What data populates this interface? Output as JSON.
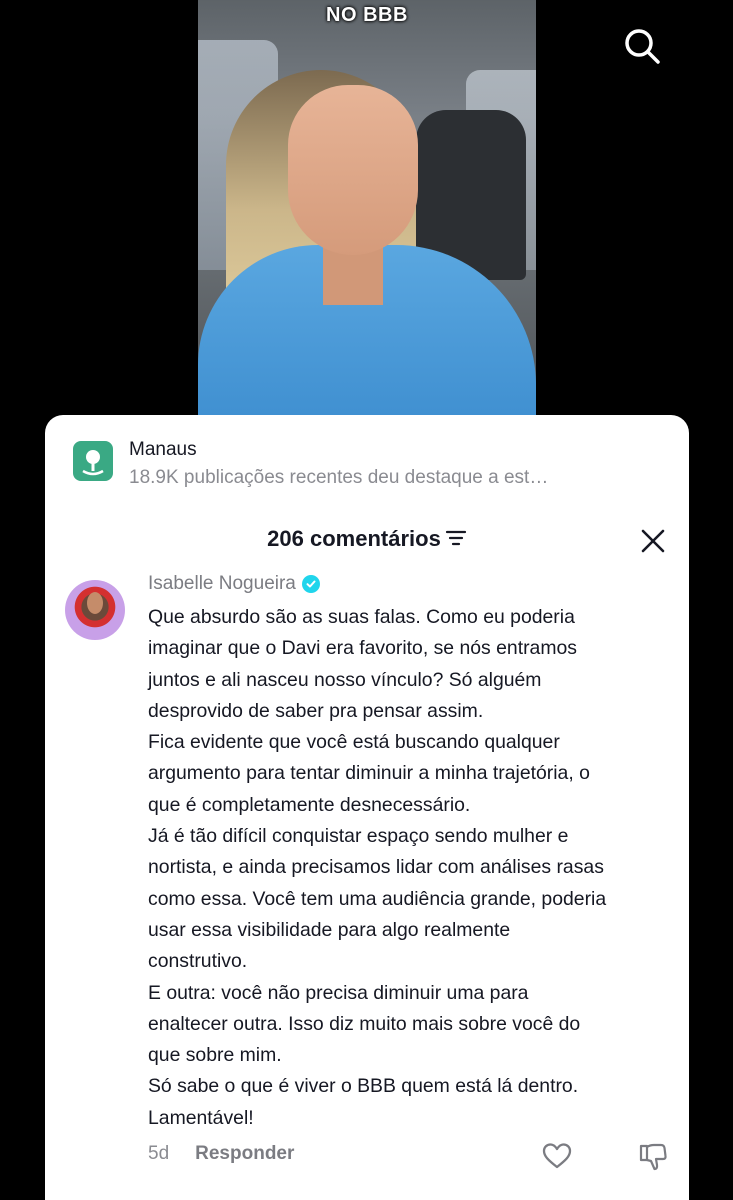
{
  "video": {
    "caption": "NO BBB"
  },
  "location": {
    "title": "Manaus",
    "subtitle": "18.9K publicações recentes deu destaque a est…"
  },
  "comments_header": {
    "count_label": "206 comentários"
  },
  "comment": {
    "author": "Isabelle Nogueira",
    "lines": [
      "Que absurdo são as suas falas. Como eu poderia",
      "imaginar que o Davi era favorito, se nós entramos",
      "juntos e ali nasceu nosso vínculo? Só alguém",
      "desprovido de saber pra pensar assim.",
      "Fica evidente que você está buscando qualquer",
      "argumento para tentar diminuir a minha trajetória, o",
      "que é completamente desnecessário.",
      "Já é tão difícil conquistar espaço sendo mulher e",
      "nortista, e ainda precisamos lidar com análises rasas",
      "como essa. Você tem uma audiência grande, poderia",
      "usar essa visibilidade para algo realmente",
      "construtivo.",
      "E outra: você não precisa diminuir uma para",
      "enaltecer outra. Isso diz muito mais sobre você do",
      "que sobre mim.",
      "Só sabe o que é viver o BBB quem está lá dentro.",
      "Lamentável!"
    ],
    "age": "5d",
    "reply_label": "Responder"
  },
  "icons": {
    "search": "search-icon",
    "location": "location-pin-icon",
    "filter": "filter-icon",
    "close": "close-icon",
    "verified": "verified-badge-icon",
    "like": "heart-icon",
    "dislike": "thumbs-down-icon"
  },
  "colors": {
    "location_icon_bg": "#3aa984",
    "verified": "#20d5ec",
    "text_primary": "#161823",
    "text_secondary": "#8a8b91"
  }
}
